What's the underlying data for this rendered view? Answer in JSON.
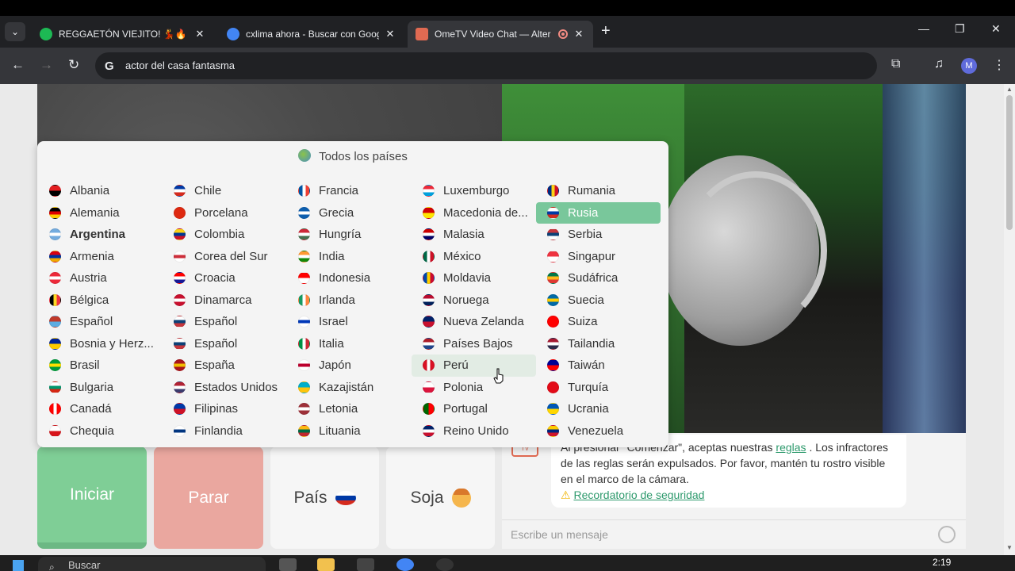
{
  "browser": {
    "tabs": [
      {
        "title": "REGGAETÓN VIEJITO! 💃🔥 - pl",
        "favicon_color": "#1db954",
        "active": false
      },
      {
        "title": "cxlima ahora - Buscar con Goog",
        "favicon_color": "#4285f4",
        "active": false
      },
      {
        "title": "OmeTV Video Chat — Alter",
        "favicon_color": "#e06a52",
        "active": true
      }
    ],
    "address_bar": "actor del casa fantasma",
    "profile_initial": "M"
  },
  "dropdown": {
    "header": "Todos los países",
    "columns": [
      [
        {
          "name": "Albania",
          "colors": [
            "#e41e20",
            "#000000"
          ]
        },
        {
          "name": "Alemania",
          "colors": [
            "#000000",
            "#dd0000",
            "#ffce00"
          ]
        },
        {
          "name": "Argentina",
          "colors": [
            "#74acdf",
            "#ffffff",
            "#74acdf"
          ],
          "bold": true
        },
        {
          "name": "Armenia",
          "colors": [
            "#d90012",
            "#0033a0",
            "#f2a800"
          ]
        },
        {
          "name": "Austria",
          "colors": [
            "#ed2939",
            "#ffffff",
            "#ed2939"
          ]
        },
        {
          "name": "Bélgica",
          "colors": [
            "#000000",
            "#fdda24",
            "#ef3340"
          ],
          "vertical": true
        },
        {
          "name": "Español",
          "colors": [
            "#c0392b",
            "#5dade2"
          ]
        },
        {
          "name": "Bosnia y Herz...",
          "colors": [
            "#002395",
            "#fecb00"
          ]
        },
        {
          "name": "Brasil",
          "colors": [
            "#009c3b",
            "#ffdf00",
            "#009c3b"
          ]
        },
        {
          "name": "Bulgaria",
          "colors": [
            "#ffffff",
            "#00966e",
            "#d62612"
          ]
        },
        {
          "name": "Canadá",
          "colors": [
            "#ff0000",
            "#ffffff",
            "#ff0000"
          ],
          "vertical": true
        },
        {
          "name": "Chequia",
          "colors": [
            "#ffffff",
            "#d7141a"
          ]
        }
      ],
      [
        {
          "name": "Chile",
          "colors": [
            "#0039a6",
            "#ffffff",
            "#d52b1e"
          ]
        },
        {
          "name": "Porcelana",
          "colors": [
            "#de2910",
            "#de2910"
          ]
        },
        {
          "name": "Colombia",
          "colors": [
            "#fcd116",
            "#003893",
            "#ce1126"
          ]
        },
        {
          "name": "Corea del Sur",
          "colors": [
            "#ffffff",
            "#cd2e3a",
            "#ffffff"
          ]
        },
        {
          "name": "Croacia",
          "colors": [
            "#ff0000",
            "#ffffff",
            "#171796"
          ]
        },
        {
          "name": "Dinamarca",
          "colors": [
            "#c8102e",
            "#ffffff",
            "#c8102e"
          ]
        },
        {
          "name": "Español",
          "colors": [
            "#ffffff",
            "#0c4076",
            "#c6363c"
          ]
        },
        {
          "name": "Español",
          "colors": [
            "#ffffff",
            "#0c4076",
            "#c6363c"
          ]
        },
        {
          "name": "España",
          "colors": [
            "#aa151b",
            "#f1bf00",
            "#aa151b"
          ]
        },
        {
          "name": "Estados Unidos",
          "colors": [
            "#b22234",
            "#ffffff",
            "#3c3b6e"
          ]
        },
        {
          "name": "Filipinas",
          "colors": [
            "#0038a8",
            "#ce1126"
          ]
        },
        {
          "name": "Finlandia",
          "colors": [
            "#ffffff",
            "#003580",
            "#ffffff"
          ]
        }
      ],
      [
        {
          "name": "Francia",
          "colors": [
            "#0055a4",
            "#ffffff",
            "#ef4135"
          ],
          "vertical": true
        },
        {
          "name": "Grecia",
          "colors": [
            "#0d5eaf",
            "#ffffff",
            "#0d5eaf"
          ]
        },
        {
          "name": "Hungría",
          "colors": [
            "#ce2939",
            "#ffffff",
            "#477050"
          ]
        },
        {
          "name": "India",
          "colors": [
            "#ff9933",
            "#ffffff",
            "#138808"
          ]
        },
        {
          "name": "Indonesia",
          "colors": [
            "#ff0000",
            "#ffffff"
          ]
        },
        {
          "name": "Irlanda",
          "colors": [
            "#169b62",
            "#ffffff",
            "#ff883e"
          ],
          "vertical": true
        },
        {
          "name": "Israel",
          "colors": [
            "#ffffff",
            "#0038b8",
            "#ffffff"
          ]
        },
        {
          "name": "Italia",
          "colors": [
            "#009246",
            "#ffffff",
            "#ce2b37"
          ],
          "vertical": true
        },
        {
          "name": "Japón",
          "colors": [
            "#ffffff",
            "#bc002d",
            "#ffffff"
          ]
        },
        {
          "name": "Kazajistán",
          "colors": [
            "#00afca",
            "#fec50c"
          ]
        },
        {
          "name": "Letonia",
          "colors": [
            "#9e3039",
            "#ffffff",
            "#9e3039"
          ]
        },
        {
          "name": "Lituania",
          "colors": [
            "#fdb913",
            "#006a44",
            "#c1272d"
          ]
        }
      ],
      [
        {
          "name": "Luxemburgo",
          "colors": [
            "#ed2939",
            "#ffffff",
            "#00a1de"
          ]
        },
        {
          "name": "Macedonia de...",
          "colors": [
            "#d20000",
            "#ffe600"
          ]
        },
        {
          "name": "Malasia",
          "colors": [
            "#cc0001",
            "#ffffff",
            "#010066"
          ]
        },
        {
          "name": "México",
          "colors": [
            "#006847",
            "#ffffff",
            "#ce1126"
          ],
          "vertical": true
        },
        {
          "name": "Moldavia",
          "colors": [
            "#0046ae",
            "#ffd200",
            "#cc092f"
          ],
          "vertical": true
        },
        {
          "name": "Noruega",
          "colors": [
            "#ba0c2f",
            "#ffffff",
            "#00205b"
          ]
        },
        {
          "name": "Nueva Zelanda",
          "colors": [
            "#012169",
            "#c8102e"
          ]
        },
        {
          "name": "Países Bajos",
          "colors": [
            "#ae1c28",
            "#ffffff",
            "#21468b"
          ]
        },
        {
          "name": "Perú",
          "colors": [
            "#d91023",
            "#ffffff",
            "#d91023"
          ],
          "vertical": true
        },
        {
          "name": "Polonia",
          "colors": [
            "#ffffff",
            "#dc143c"
          ]
        },
        {
          "name": "Portugal",
          "colors": [
            "#006600",
            "#ff0000"
          ],
          "vertical": true
        },
        {
          "name": "Reino Unido",
          "colors": [
            "#012169",
            "#ffffff",
            "#c8102e"
          ]
        }
      ],
      [
        {
          "name": "Rumania",
          "colors": [
            "#002b7f",
            "#fcd116",
            "#ce1126"
          ],
          "vertical": true
        },
        {
          "name": "Rusia",
          "colors": [
            "#ffffff",
            "#0039a6",
            "#d52b1e"
          ],
          "selected": true
        },
        {
          "name": "Serbia",
          "colors": [
            "#c6363c",
            "#0c4076",
            "#ffffff"
          ]
        },
        {
          "name": "Singapur",
          "colors": [
            "#ef3340",
            "#ffffff"
          ]
        },
        {
          "name": "Sudáfrica",
          "colors": [
            "#007749",
            "#ffb81c",
            "#de3831"
          ]
        },
        {
          "name": "Suecia",
          "colors": [
            "#006aa7",
            "#fecc00",
            "#006aa7"
          ]
        },
        {
          "name": "Suiza",
          "colors": [
            "#ff0000",
            "#ff0000"
          ]
        },
        {
          "name": "Tailandia",
          "colors": [
            "#a51931",
            "#ffffff",
            "#2d2a4a"
          ]
        },
        {
          "name": "Taiwán",
          "colors": [
            "#000095",
            "#fe0000"
          ]
        },
        {
          "name": "Turquía",
          "colors": [
            "#e30a17",
            "#e30a17"
          ]
        },
        {
          "name": "Ucrania",
          "colors": [
            "#0057b7",
            "#ffd700"
          ]
        },
        {
          "name": "Venezuela",
          "colors": [
            "#ffcc00",
            "#00247d",
            "#cf142b"
          ]
        }
      ]
    ]
  },
  "controls": {
    "start": "Iniciar",
    "stop": "Parar",
    "country": "País",
    "gender": "Soja"
  },
  "chat": {
    "message_part1": "Al presionar \"Comenzar\", aceptas nuestras",
    "message_link": "reglas",
    "message_part2": ". Los infractores de las reglas serán expulsados. Por favor, mantén tu rostro visible en el marco de la cámara.",
    "safety_link": "Recordatorio de seguridad",
    "input_placeholder": "Escribe un mensaje",
    "tv_label": "TV"
  },
  "taskbar": {
    "search_placeholder": "Buscar",
    "clock": "2:19"
  }
}
